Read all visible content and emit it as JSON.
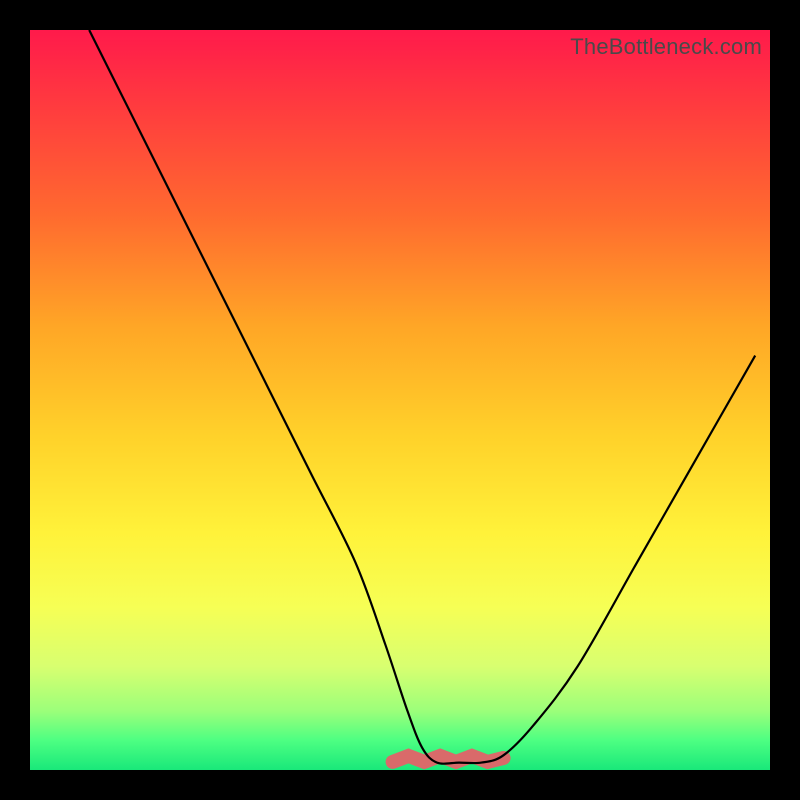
{
  "watermark": "TheBottleneck.com",
  "chart_data": {
    "type": "line",
    "title": "",
    "xlabel": "",
    "ylabel": "",
    "xlim": [
      0,
      100
    ],
    "ylim": [
      0,
      100
    ],
    "grid": false,
    "series": [
      {
        "name": "curve",
        "x": [
          8,
          12,
          18,
          25,
          32,
          38,
          44,
          48,
          51,
          53,
          55,
          58,
          61,
          64,
          68,
          74,
          82,
          90,
          98
        ],
        "values": [
          100,
          92,
          80,
          66,
          52,
          40,
          28,
          17,
          8,
          3,
          1,
          1,
          1,
          2,
          6,
          14,
          28,
          42,
          56
        ]
      }
    ],
    "annotations": {
      "bottom_marker_range_x": [
        49,
        64
      ],
      "bottom_marker_y": 1.5,
      "bottom_marker_color": "#d96a6a"
    }
  }
}
